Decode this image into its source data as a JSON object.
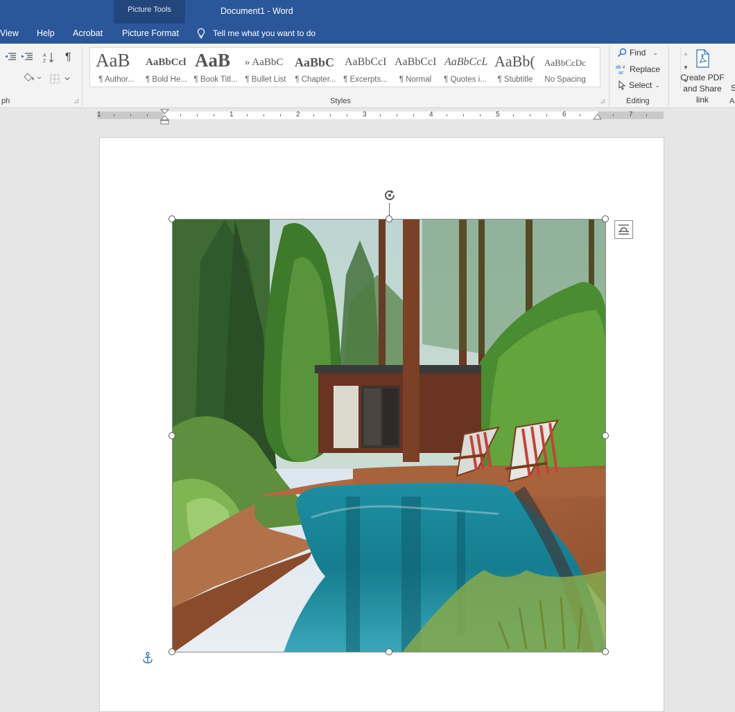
{
  "window": {
    "doc_title": "Document1  -  Word"
  },
  "context_tab_group": "Picture Tools",
  "tabs": [
    "View",
    "Help",
    "Acrobat",
    "Picture Format"
  ],
  "tell_me": "Tell me what you want to do",
  "ribbon": {
    "paragraph_label": "ph",
    "styles_label": "Styles",
    "editing_label": "Editing",
    "next_group_label": "A",
    "styles": [
      {
        "sample": "AaB",
        "name": "¶ Author..."
      },
      {
        "sample": "AaBbCcl",
        "name": "¶ Bold He..."
      },
      {
        "sample": "AaB",
        "name": "¶ Book Titl..."
      },
      {
        "sample": "» AaBbC",
        "name": "¶ Bullet List"
      },
      {
        "sample": "AaBbC",
        "name": "¶ Chapter..."
      },
      {
        "sample": "AaBbCcI",
        "name": "¶ Excerpts..."
      },
      {
        "sample": "AaBbCcI",
        "name": "¶ Normal"
      },
      {
        "sample": "AaBbCcL",
        "name": "¶ Quotes i..."
      },
      {
        "sample": "AaBb(",
        "name": "¶ Stubtitle"
      },
      {
        "sample": "AaBbCcDc",
        "name": "No Spacing"
      }
    ],
    "find": "Find",
    "replace": "Replace",
    "select": "Select",
    "create_pdf": "Create PDF",
    "and_share": "and Share link",
    "partial_s": "S"
  },
  "ruler": {
    "numbers": [
      "1",
      "1",
      "2",
      "3",
      "4",
      "5",
      "6",
      "7"
    ]
  },
  "colors": {
    "titlebar": "#2b579a",
    "context_group": "#23477d",
    "ribbon": "#f3f3f3",
    "canvas": "#e6e6e6",
    "accent_blue": "#2b6fbf"
  },
  "icons": [
    "decrease-indent-icon",
    "increase-indent-icon",
    "sort-icon",
    "pilcrow-icon",
    "shading-icon",
    "borders-icon",
    "lightbulb-icon",
    "find-icon",
    "replace-icon",
    "select-icon",
    "pdf-icon",
    "rotate-icon",
    "layout-options-icon",
    "anchor-icon"
  ]
}
